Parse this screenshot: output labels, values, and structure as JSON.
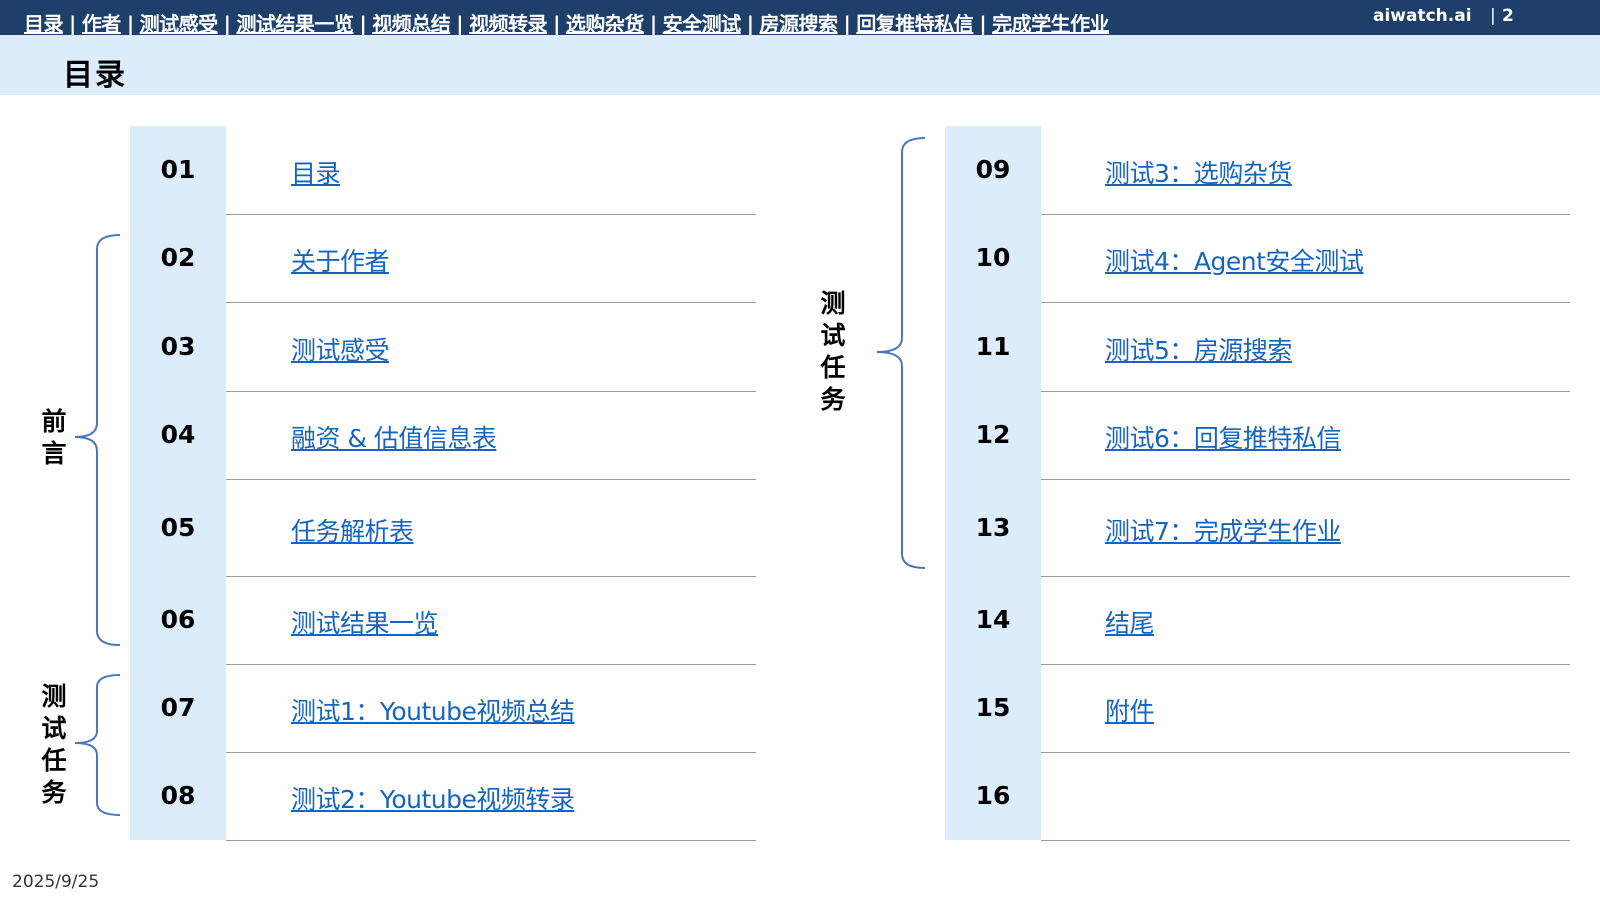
{
  "topnav": {
    "items": [
      "目录",
      "作者",
      "测试感受",
      "测试结果一览",
      "视频总结",
      "视频转录",
      "选购杂货",
      "安全测试",
      "房源搜索",
      "回复推特私信",
      "完成学生作业"
    ],
    "separator": "|",
    "brand": "aiwatch.ai",
    "brand_separator": "|",
    "page_number": "2"
  },
  "page_title": "目录",
  "groups": {
    "preface": "前言",
    "tasks_left": "测试任务",
    "tasks_right": "测试任务"
  },
  "toc_left": [
    {
      "num": "01",
      "label": "目录"
    },
    {
      "num": "02",
      "label": "关于作者"
    },
    {
      "num": "03",
      "label": "测试感受"
    },
    {
      "num": "04",
      "label": "融资 & 估值信息表"
    },
    {
      "num": "05",
      "label": "任务解析表"
    },
    {
      "num": "06",
      "label": "测试结果一览"
    },
    {
      "num": "07",
      "label": "测试1：Youtube视频总结"
    },
    {
      "num": "08",
      "label": "测试2：Youtube视频转录"
    }
  ],
  "toc_right": [
    {
      "num": "09",
      "label": "测试3：选购杂货"
    },
    {
      "num": "10",
      "label": "测试4：Agent安全测试"
    },
    {
      "num": "11",
      "label": "测试5：房源搜索"
    },
    {
      "num": "12",
      "label": "测试6：回复推特私信"
    },
    {
      "num": "13",
      "label": "测试7：完成学生作业"
    },
    {
      "num": "14",
      "label": "结尾"
    },
    {
      "num": "15",
      "label": "附件"
    },
    {
      "num": "16",
      "label": ""
    }
  ],
  "footer": {
    "date": "2025/9/25"
  },
  "colors": {
    "nav_bg": "#1f3f6b",
    "band_bg": "#dcecfb",
    "link": "#1565c0",
    "brace": "#4a78c0"
  }
}
